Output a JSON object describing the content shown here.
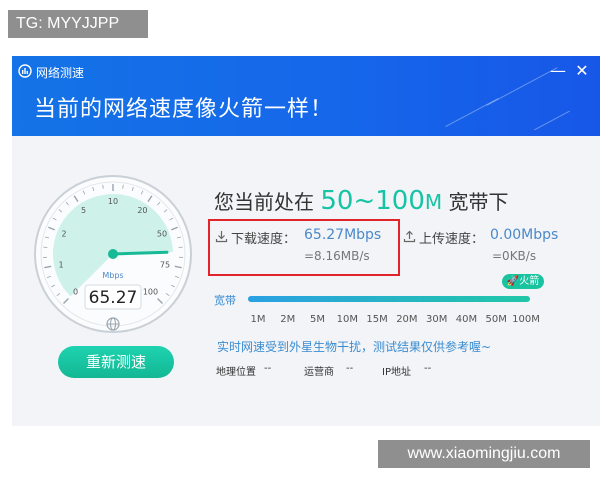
{
  "overlay": {
    "tg": "TG: MYYJJPP",
    "watermark": "www.xiaomingjiu.com"
  },
  "window": {
    "title": "网络测速",
    "headline": "当前的网络速度像火箭一样！",
    "min": "—",
    "close": "✕"
  },
  "gauge": {
    "unit": "Mbps",
    "value": "65.27",
    "level": 65.27,
    "ticks": [
      "0",
      "1",
      "2",
      "5",
      "10",
      "20",
      "50",
      "75",
      "100"
    ]
  },
  "result": {
    "prefix": "您当前处在 ",
    "range": "50~100",
    "unit_m": "M",
    "suffix": " 宽带下"
  },
  "download": {
    "label": "下载速度：",
    "value": "65.27Mbps",
    "sub": "=8.16MB/s"
  },
  "upload": {
    "label": "上传速度：",
    "value": "0.00Mbps",
    "sub": "=0KB/s"
  },
  "bandwidth": {
    "label": "宽带",
    "fill": 1.0,
    "badge": "火箭",
    "ticks": [
      "1M",
      "2M",
      "5M",
      "10M",
      "15M",
      "20M",
      "30M",
      "40M",
      "50M",
      "100M"
    ]
  },
  "note": "实时网速受到外星生物干扰，测试结果仅供参考喔~",
  "info": {
    "location_label": "地理位置",
    "location_value": "--",
    "isp_label": "运营商",
    "isp_value": "--",
    "ip_label": "IP地址",
    "ip_value": "--"
  },
  "retest_label": "重新测速",
  "colors": {
    "titlebar": "#1667ea",
    "accent": "#17c3a5",
    "link": "#4b89c8",
    "highlight_border": "#e0242a"
  }
}
